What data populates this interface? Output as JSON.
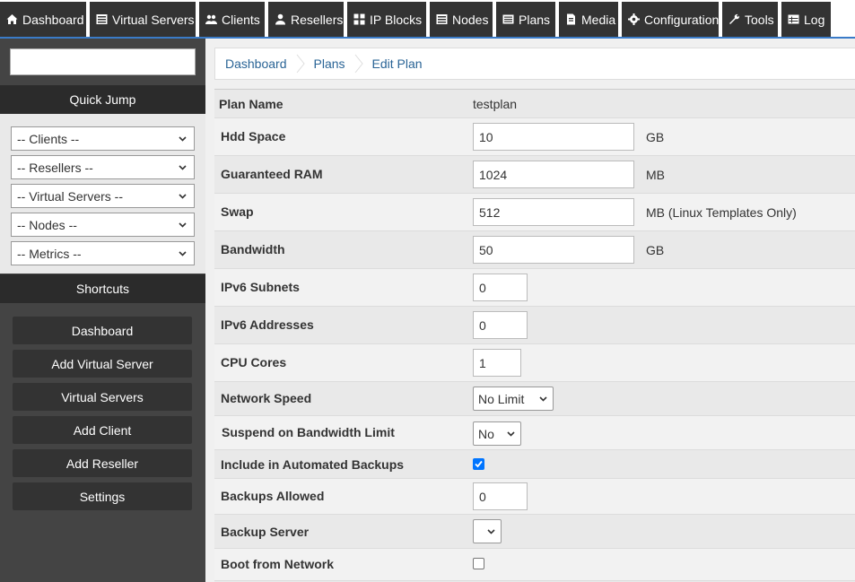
{
  "nav": {
    "tabs": [
      {
        "label": "Dashboard",
        "icon": "home-icon"
      },
      {
        "label": "Virtual Servers",
        "icon": "server-icon"
      },
      {
        "label": "Clients",
        "icon": "users-icon"
      },
      {
        "label": "Resellers",
        "icon": "user-icon"
      },
      {
        "label": "IP Blocks",
        "icon": "grid-icon"
      },
      {
        "label": "Nodes",
        "icon": "server-icon"
      },
      {
        "label": "Plans",
        "icon": "list-icon"
      },
      {
        "label": "Media",
        "icon": "file-icon"
      },
      {
        "label": "Configuration",
        "icon": "gear-icon"
      },
      {
        "label": "Tools",
        "icon": "wrench-icon"
      },
      {
        "label": "Log",
        "icon": "table-icon"
      }
    ]
  },
  "sidebar": {
    "search_value": "",
    "quick_jump_title": "Quick Jump",
    "quick_jump": [
      "-- Clients --",
      "-- Resellers --",
      "-- Virtual Servers --",
      "-- Nodes --",
      "-- Metrics --"
    ],
    "shortcuts_title": "Shortcuts",
    "shortcuts": [
      "Dashboard",
      "Add Virtual Server",
      "Virtual Servers",
      "Add Client",
      "Add Reseller",
      "Settings"
    ]
  },
  "breadcrumb": [
    "Dashboard",
    "Plans",
    "Edit Plan"
  ],
  "form": {
    "plan_name": {
      "label": "Plan Name",
      "value": "testplan"
    },
    "hdd": {
      "label": "Hdd Space",
      "value": "10",
      "unit": "GB"
    },
    "ram": {
      "label": "Guaranteed RAM",
      "value": "1024",
      "unit": "MB"
    },
    "swap": {
      "label": "Swap",
      "value": "512",
      "unit": "MB (Linux Templates Only)"
    },
    "bandwidth": {
      "label": "Bandwidth",
      "value": "50",
      "unit": "GB"
    },
    "ipv6_subnets": {
      "label": "IPv6 Subnets",
      "value": "0"
    },
    "ipv6_addresses": {
      "label": "IPv6 Addresses",
      "value": "0"
    },
    "cpu_cores": {
      "label": "CPU Cores",
      "value": "1"
    },
    "network_speed": {
      "label": "Network Speed",
      "value": "No Limit"
    },
    "suspend_bw": {
      "label": "Suspend on Bandwidth Limit",
      "value": "No"
    },
    "auto_backups": {
      "label": "Include in Automated Backups",
      "checked": true
    },
    "backups_allowed": {
      "label": "Backups Allowed",
      "value": "0"
    },
    "backup_server": {
      "label": "Backup Server",
      "value": ""
    },
    "boot_network": {
      "label": "Boot from Network",
      "checked": false
    }
  },
  "colors": {
    "nav_bg": "#333333",
    "accent": "#3a7bc8",
    "checkbox": "#0075ff",
    "link": "#2a6496"
  }
}
